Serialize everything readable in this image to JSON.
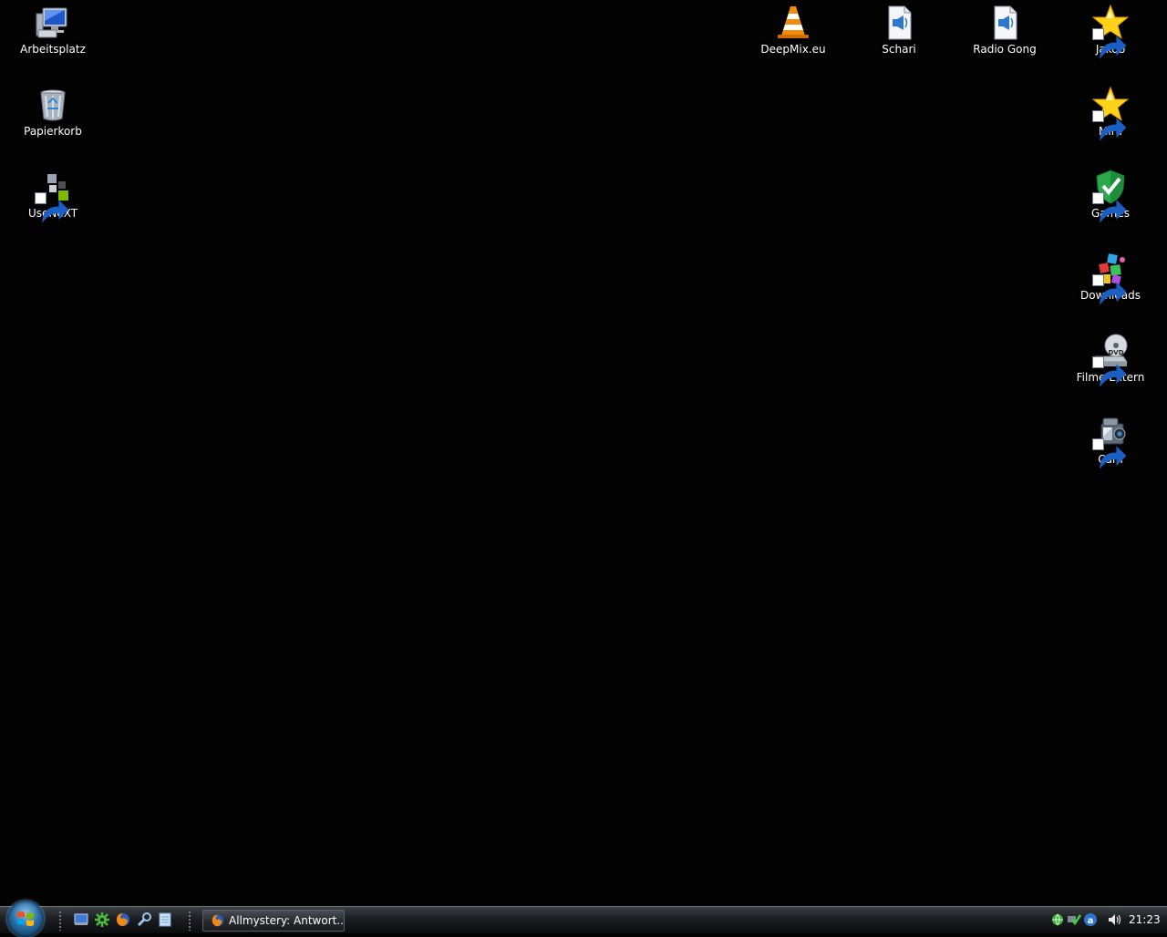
{
  "desktop": {
    "icons_left": [
      {
        "label": "Arbeitsplatz",
        "icon": "computer-icon"
      },
      {
        "label": "Papierkorb",
        "icon": "recycle-bin-icon"
      },
      {
        "label": "UseNeXT",
        "icon": "usenext-icon"
      }
    ],
    "icons_top": [
      {
        "label": "DeepMix.eu",
        "icon": "vlc-cone-icon"
      },
      {
        "label": "Schari",
        "icon": "audio-file-icon"
      },
      {
        "label": "Radio Gong",
        "icon": "audio-file-icon"
      }
    ],
    "icons_right": [
      {
        "label": "Jakob",
        "icon": "star-icon"
      },
      {
        "label": "Mira",
        "icon": "star-icon"
      },
      {
        "label": "Games",
        "icon": "shield-check-icon"
      },
      {
        "label": "Downloads",
        "icon": "downloads-icon"
      },
      {
        "label": "Filme Extern",
        "icon": "dvd-drive-icon"
      },
      {
        "label": "Cam",
        "icon": "camcorder-icon"
      }
    ]
  },
  "taskbar": {
    "task_button": {
      "label": "Allmystery: Antwort...",
      "icon": "firefox-icon"
    },
    "clock": "21:23"
  },
  "colors": {
    "desktop_bg": "#030303",
    "taskbar_bg": "#1b1d20"
  }
}
